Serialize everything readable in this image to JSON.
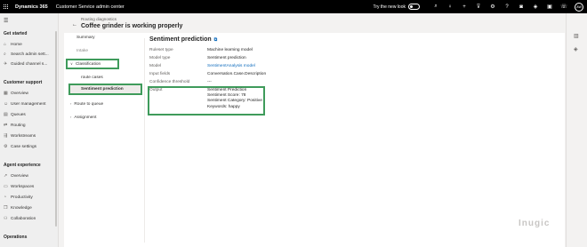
{
  "topbar": {
    "brand": "Dynamics 365",
    "app_title": "Customer Service admin center",
    "try_new_look": "Try the new look",
    "avatar_initials": "AW"
  },
  "leftnav": {
    "sections": [
      {
        "title": "Get started",
        "items": [
          "Home",
          "Search admin sett...",
          "Guided channel s..."
        ]
      },
      {
        "title": "Customer support",
        "items": [
          "Overview",
          "User management",
          "Queues",
          "Routing",
          "Workstreams",
          "Case settings"
        ]
      },
      {
        "title": "Agent experience",
        "items": [
          "Overview",
          "Workspaces",
          "Productivity",
          "Knowledge",
          "Collaboration"
        ]
      },
      {
        "title": "Operations",
        "items": []
      }
    ]
  },
  "header": {
    "breadcrumb": "Routing diagnostics",
    "title": "Coffee grinder is working properly"
  },
  "steps": {
    "summary": "Summary",
    "intake": "Intake",
    "classification": "Classification",
    "route_cases": "route cases",
    "sentiment_prediction": "Sentiment prediction",
    "route_to_queue": "Route to queue",
    "assignment": "Assignment"
  },
  "detail": {
    "title": "Sentiment prediction",
    "rows": [
      {
        "k": "Ruleset type",
        "v": "Machine learning model"
      },
      {
        "k": "Model type",
        "v": "Sentiment prediction"
      },
      {
        "k": "Model",
        "v": "SentimentAnalysis model"
      },
      {
        "k": "Input fields",
        "v": "Conversation.Case.Description"
      },
      {
        "k": "Confidence threshold",
        "v": "---"
      }
    ],
    "output_label": "Output",
    "output_lines": [
      "Sentiment Prediction",
      "Sentiment Score: 78",
      "Sentiment Category: Positive",
      "Keywords: happy"
    ]
  },
  "watermark": "Inugic",
  "colors": {
    "highlight": "#3f9b5b",
    "link": "#0f6cbd",
    "topbar": "#000000"
  }
}
